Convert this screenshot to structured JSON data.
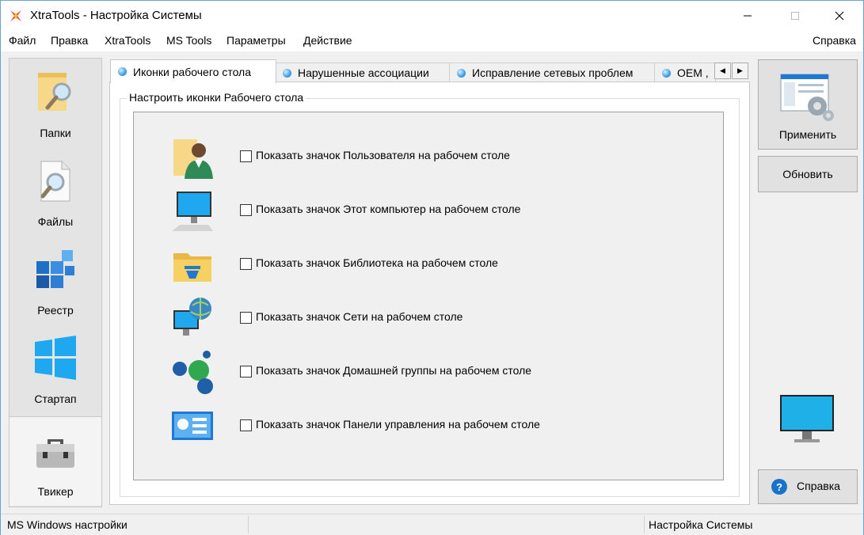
{
  "window": {
    "title": "XtraTools - Настройка Системы",
    "accent": "#6e9ed8"
  },
  "menu": {
    "items": [
      "Файл",
      "Правка",
      "XtraTools",
      "MS Tools",
      "Параметры",
      "Действие"
    ],
    "help": "Справка"
  },
  "sidebar": {
    "items": [
      {
        "label": "Папки",
        "icon": "folder-search-icon"
      },
      {
        "label": "Файлы",
        "icon": "file-search-icon"
      },
      {
        "label": "Реестр",
        "icon": "registry-cubes-icon"
      },
      {
        "label": "Стартап",
        "icon": "windows-logo-icon"
      },
      {
        "label": "Твикер",
        "icon": "toolbox-icon",
        "active": true
      }
    ]
  },
  "tabs": {
    "items": [
      {
        "label": "Иконки рабочего стола",
        "active": true
      },
      {
        "label": "Нарушенные ассоциации"
      },
      {
        "label": "Исправление сетевых проблем"
      },
      {
        "label": "OEM ,"
      }
    ]
  },
  "panel": {
    "group_title": "Настроить иконки Рабочего стола",
    "rows": [
      {
        "label": "Показать значок Пользователя на рабочем столе",
        "icon": "user-folder-icon",
        "checked": false
      },
      {
        "label": "Показать значок Этот компьютер на рабочем столе",
        "icon": "computer-icon",
        "checked": false
      },
      {
        "label": "Показать значок Библиотека на рабочем столе",
        "icon": "library-folder-icon",
        "checked": false
      },
      {
        "label": "Показать значок Сети на рабочем столе",
        "icon": "network-globe-icon",
        "checked": false
      },
      {
        "label": "Показать значок Домашней группы на рабочем столе",
        "icon": "homegroup-icon",
        "checked": false
      },
      {
        "label": "Показать значок Панели управления на рабочем столе",
        "icon": "control-panel-icon",
        "checked": false
      }
    ]
  },
  "actions": {
    "apply": "Применить",
    "refresh": "Обновить",
    "help": "Справка"
  },
  "status": {
    "left": "MS Windows настройки",
    "right": "Настройка Системы"
  }
}
